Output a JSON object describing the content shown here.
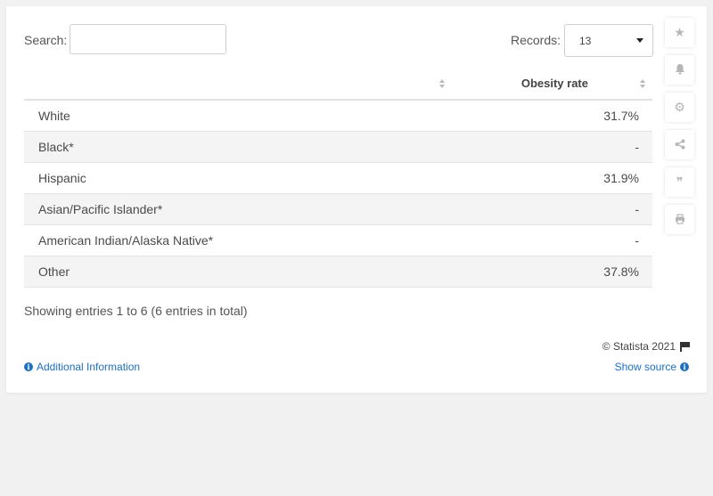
{
  "search": {
    "label": "Search:",
    "value": "",
    "placeholder": ""
  },
  "records": {
    "label": "Records:",
    "value": "13"
  },
  "table": {
    "columns": [
      "",
      "Obesity rate"
    ],
    "rows": [
      {
        "category": "White",
        "rate": "31.7%"
      },
      {
        "category": "Black*",
        "rate": "-"
      },
      {
        "category": "Hispanic",
        "rate": "31.9%"
      },
      {
        "category": "Asian/Pacific Islander*",
        "rate": "-"
      },
      {
        "category": "American Indian/Alaska Native*",
        "rate": "-"
      },
      {
        "category": "Other",
        "rate": "37.8%"
      }
    ]
  },
  "footer": {
    "showing": "Showing entries 1 to 6 (6 entries in total)",
    "copyright": "© Statista 2021",
    "additional_info": "Additional Information",
    "show_source": "Show source"
  },
  "sidebar": {
    "buttons": [
      {
        "icon": "star-icon",
        "glyph": "★"
      },
      {
        "icon": "bell-icon",
        "glyph": "🔔"
      },
      {
        "icon": "gear-icon",
        "glyph": "⚙"
      },
      {
        "icon": "share-icon",
        "glyph": "⋖"
      },
      {
        "icon": "quote-icon",
        "glyph": "❞"
      },
      {
        "icon": "print-icon",
        "glyph": "⎙"
      }
    ]
  },
  "colors": {
    "link": "#1f6fbf",
    "background": "#f1f1f1",
    "card": "#ffffff",
    "row_alt": "#f4f4f4"
  }
}
